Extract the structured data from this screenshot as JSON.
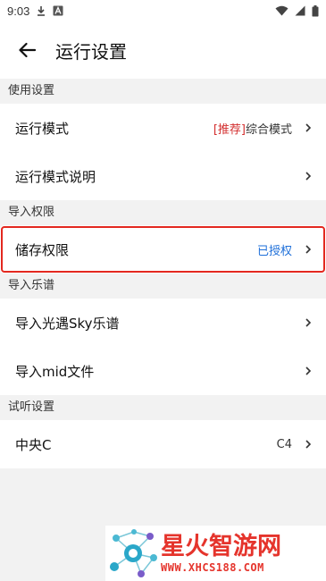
{
  "status_bar": {
    "time": "9:03"
  },
  "toolbar": {
    "title": "运行设置",
    "back_icon": "arrow-left-icon"
  },
  "sections": [
    {
      "header": "使用设置",
      "rows": [
        {
          "label": "运行模式",
          "value_tag": "[推荐]",
          "value": "综合模式"
        },
        {
          "label": "运行模式说明",
          "value_tag": "",
          "value": ""
        }
      ]
    },
    {
      "header": "导入权限",
      "rows": [
        {
          "label": "储存权限",
          "value_tag": "",
          "value": "已授权"
        }
      ]
    },
    {
      "header": "导入乐谱",
      "rows": [
        {
          "label": "导入光遇Sky乐谱",
          "value_tag": "",
          "value": ""
        },
        {
          "label": "导入mid文件",
          "value_tag": "",
          "value": ""
        }
      ]
    },
    {
      "header": "试听设置",
      "rows": [
        {
          "label": "中央C",
          "value_tag": "",
          "value": "C4"
        }
      ]
    }
  ],
  "colors": {
    "accent_red": "#d32f2f",
    "granted_blue": "#1e6fd9",
    "highlight_outline": "#e3281f"
  },
  "watermark": {
    "title": "星火智游网",
    "url": "WWW.XHCS188.COM"
  }
}
